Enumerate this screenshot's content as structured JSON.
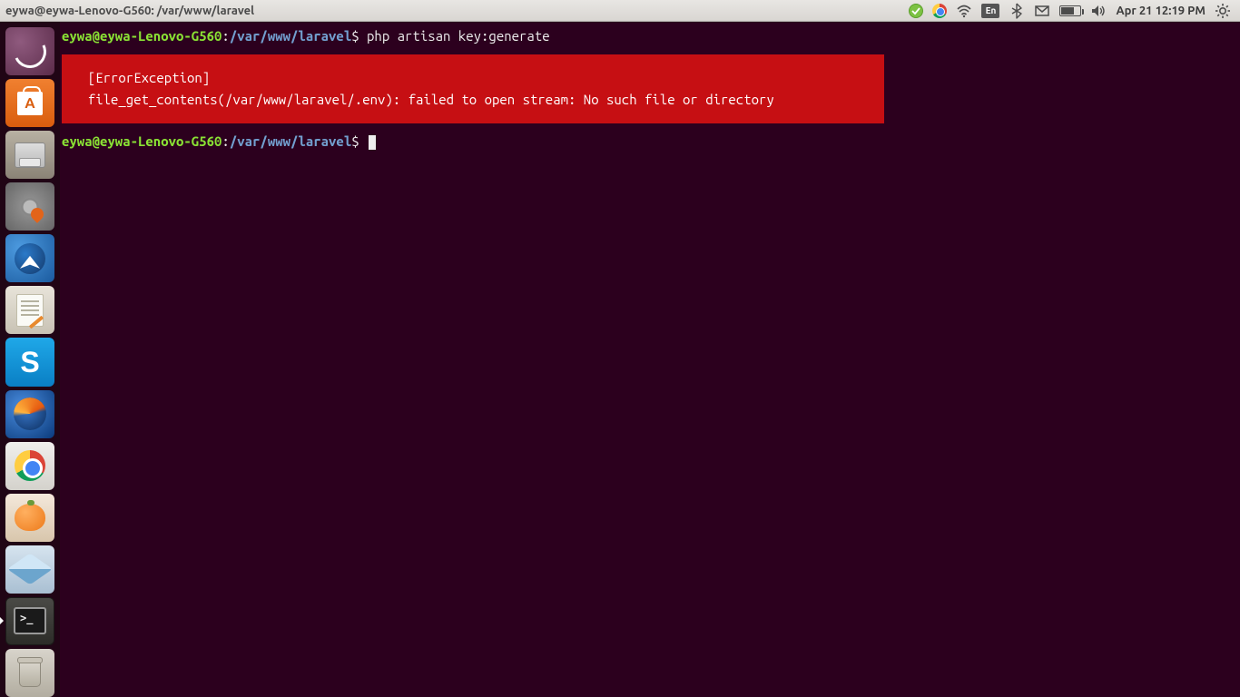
{
  "topbar": {
    "window_title": "eywa@eywa-Lenovo-G560: /var/www/laravel",
    "language_badge": "En",
    "datetime": "Apr 21 12:19 PM"
  },
  "terminal": {
    "prompt_user_host": "eywa@eywa-Lenovo-G560",
    "prompt_separator": ":",
    "prompt_path": "/var/www/laravel",
    "prompt_symbol": "$",
    "command": "php artisan key:generate",
    "error": {
      "lines": [
        "  [ErrorException]                                                                                       ",
        "  file_get_contents(/var/www/laravel/.env): failed to open stream: No such file or directory             "
      ]
    }
  },
  "launcher": {
    "items": [
      {
        "name": "dash",
        "label": "Dash"
      },
      {
        "name": "software",
        "label": "Ubuntu Software Center"
      },
      {
        "name": "files",
        "label": "Files"
      },
      {
        "name": "settings",
        "label": "System Settings"
      },
      {
        "name": "thunderbird",
        "label": "Thunderbird"
      },
      {
        "name": "gedit",
        "label": "Text Editor"
      },
      {
        "name": "skype",
        "label": "Skype"
      },
      {
        "name": "firefox",
        "label": "Firefox"
      },
      {
        "name": "chrome",
        "label": "Google Chrome"
      },
      {
        "name": "clementine",
        "label": "Clementine"
      },
      {
        "name": "virtualbox",
        "label": "VirtualBox"
      },
      {
        "name": "terminal",
        "label": "Terminal"
      },
      {
        "name": "trash",
        "label": "Trash"
      }
    ]
  }
}
